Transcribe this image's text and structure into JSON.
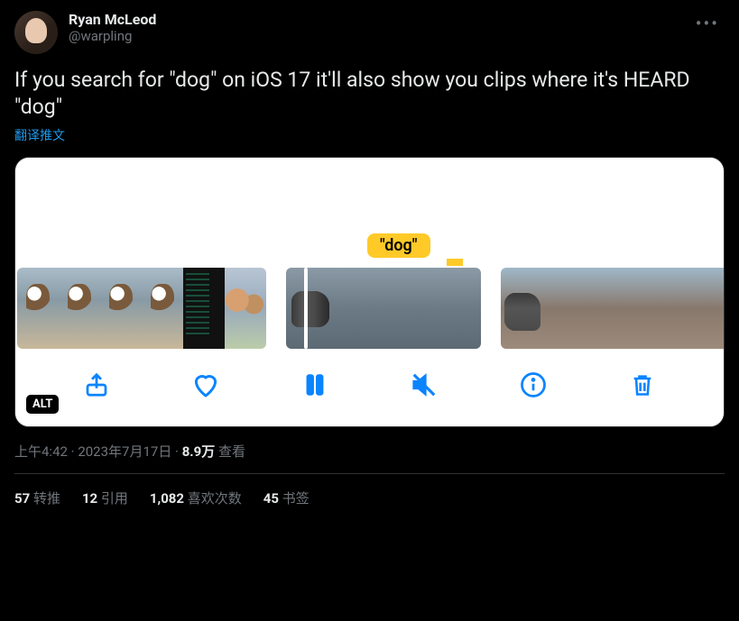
{
  "author": {
    "display_name": "Ryan McLeod",
    "handle": "@warpling"
  },
  "body": "If you search for \"dog\" on iOS 17 it'll also show you clips where it's HEARD \"dog\"",
  "translate": "翻译推文",
  "media": {
    "tag": "\"dog\"",
    "alt_badge": "ALT"
  },
  "timestamp": {
    "time": "上午4:42",
    "sep1": " · ",
    "date": "2023年7月17日",
    "sep2": " · ",
    "views_num": "8.9万",
    "views_label": " 查看"
  },
  "stats": {
    "retweets_num": "57",
    "retweets_label": " 转推",
    "quotes_num": "12",
    "quotes_label": " 引用",
    "likes_num": "1,082",
    "likes_label": " 喜欢次数",
    "bookmarks_num": "45",
    "bookmarks_label": " 书签"
  }
}
